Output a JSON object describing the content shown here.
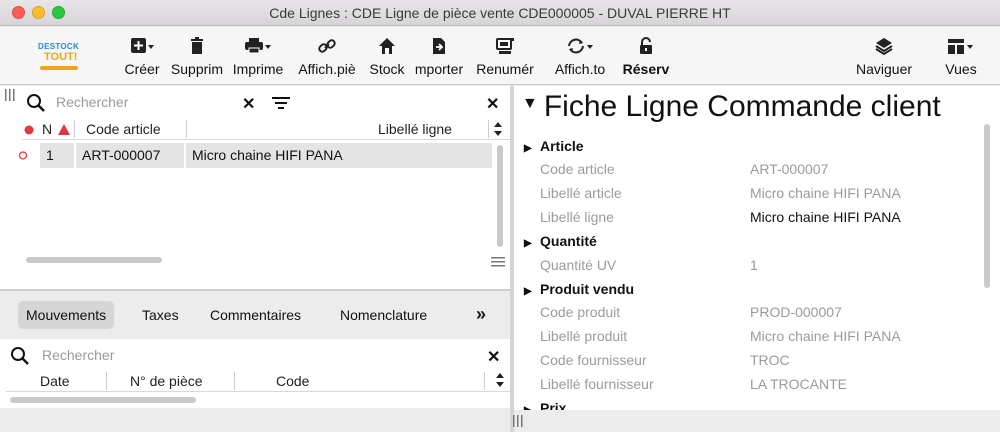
{
  "window": {
    "title": "Cde Lignes : CDE Ligne de pièce vente CDE000005 - DUVAL PIERRE HT"
  },
  "logo": {
    "line1": "DESTOCK",
    "line2": "TOUT!"
  },
  "toolbar": {
    "creer": "Créer",
    "supprim": "Supprim",
    "imprime": "Imprime",
    "affich_pie": "Affich.piè",
    "stock": "Stock",
    "importer": "mporter",
    "renumer": "Renumér",
    "affich_to": "Affich.to",
    "reserv": "Réserv",
    "naviguer": "Naviguer",
    "vues": "Vues"
  },
  "list": {
    "search_placeholder": "Rechercher",
    "columns": [
      "N",
      "Code article",
      "Libellé ligne"
    ],
    "rows": [
      {
        "n": "1",
        "code": "ART-000007",
        "libelle": "Micro chaine HIFI PANA"
      }
    ]
  },
  "tabs": [
    "Mouvements",
    "Taxes",
    "Commentaires",
    "Nomenclature"
  ],
  "tabs_more": "»",
  "movements": {
    "search_placeholder": "Rechercher",
    "columns": [
      "Date",
      "N° de pièce",
      "Code"
    ]
  },
  "fiche": {
    "title": "Fiche Ligne Commande client",
    "sections": {
      "article": "Article",
      "quantite": "Quantité",
      "produit": "Produit vendu",
      "prix": "Prix"
    },
    "fields": {
      "code_article": {
        "label": "Code article",
        "value": "ART-000007"
      },
      "libelle_article": {
        "label": "Libellé article",
        "value": "Micro chaine HIFI PANA"
      },
      "libelle_ligne": {
        "label": "Libellé ligne",
        "value": "Micro chaine HIFI PANA"
      },
      "quantite_uv": {
        "label": "Quantité UV",
        "value": "1"
      },
      "code_produit": {
        "label": "Code produit",
        "value": "PROD-000007"
      },
      "libelle_produit": {
        "label": "Libellé produit",
        "value": "Micro chaine HIFI PANA"
      },
      "code_fournisseur": {
        "label": "Code fournisseur",
        "value": "TROC"
      },
      "libelle_fournisseur": {
        "label": "Libellé fournisseur",
        "value": "LA TROCANTE"
      }
    }
  },
  "colors": {
    "accent_red": "#e0393e",
    "selected_row": "#e4e4e4",
    "muted_text": "#9b9b9b",
    "logo_blue": "#2c8ad3",
    "logo_orange": "#f0a41d"
  }
}
